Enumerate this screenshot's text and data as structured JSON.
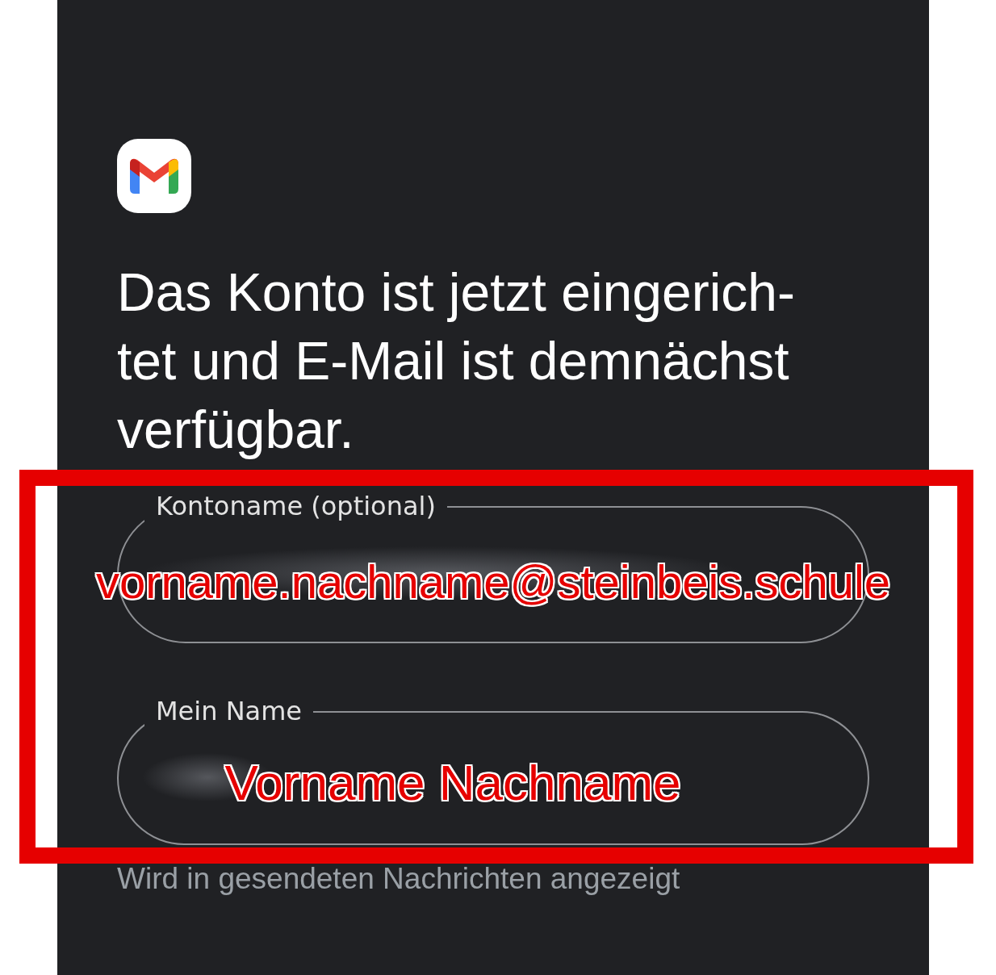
{
  "heading": "Das Konto ist jetzt eingerich-\ntet und E-Mail ist demnächst\nverfügbar.",
  "fields": [
    {
      "label": "Kontoname (optional)",
      "annotation": "vorname.nachname@steinbeis.schule"
    },
    {
      "label": "Mein Name",
      "annotation": "Vorname Nachname"
    }
  ],
  "helper": "Wird in gesendeten Nachrichten angezeigt"
}
